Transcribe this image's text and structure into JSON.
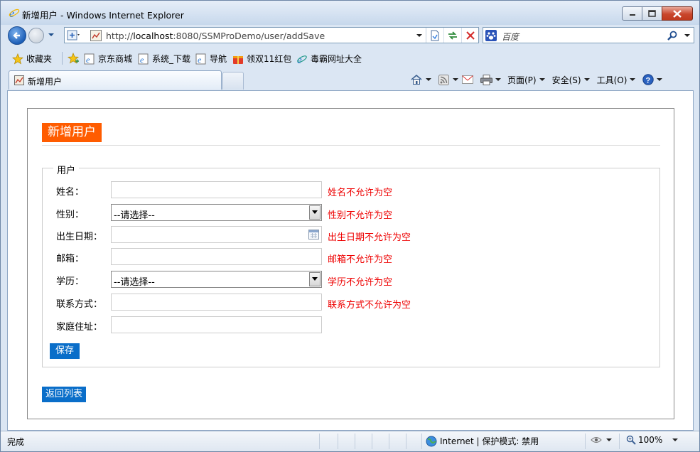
{
  "window": {
    "title": "新增用户 - Windows Internet Explorer"
  },
  "navbar": {
    "url_prefix": "http://",
    "url_host": "localhost",
    "url_rest": ":8080/SSMProDemo/user/addSave",
    "search_placeholder": "百度"
  },
  "favorites": {
    "favorites_label": "收藏夹",
    "items": [
      {
        "label": "京东商城"
      },
      {
        "label": "系统_下载"
      },
      {
        "label": "导航"
      },
      {
        "label": "领双11红包"
      },
      {
        "label": "毒霸网址大全"
      }
    ]
  },
  "tabs": {
    "active_tab": "新增用户"
  },
  "commands": {
    "page": "页面(P)",
    "safety": "安全(S)",
    "tools": "工具(O)"
  },
  "page": {
    "title": "新增用户",
    "fieldset_legend": "用户",
    "fields": [
      {
        "label": "姓名：",
        "type": "text",
        "value": "",
        "error": "姓名不允许为空"
      },
      {
        "label": "性别：",
        "type": "select",
        "value": "--请选择--",
        "error": "性别不允许为空"
      },
      {
        "label": "出生日期：",
        "type": "date",
        "value": "",
        "error": "出生日期不允许为空"
      },
      {
        "label": "邮箱：",
        "type": "text",
        "value": "",
        "error": "邮箱不允许为空"
      },
      {
        "label": "学历：",
        "type": "select",
        "value": "--请选择--",
        "error": "学历不允许为空"
      },
      {
        "label": "联系方式：",
        "type": "text",
        "value": "",
        "error": "联系方式不允许为空"
      },
      {
        "label": "家庭住址：",
        "type": "text",
        "value": "",
        "error": ""
      }
    ],
    "save_label": "保存",
    "back_label": "返回列表"
  },
  "status": {
    "left": "完成",
    "zone": "Internet | 保护模式: 禁用",
    "zoom": "100%"
  },
  "colors": {
    "title_bg": "#ff5c00",
    "button_bg": "#0a6ec9",
    "error": "#e00000"
  }
}
